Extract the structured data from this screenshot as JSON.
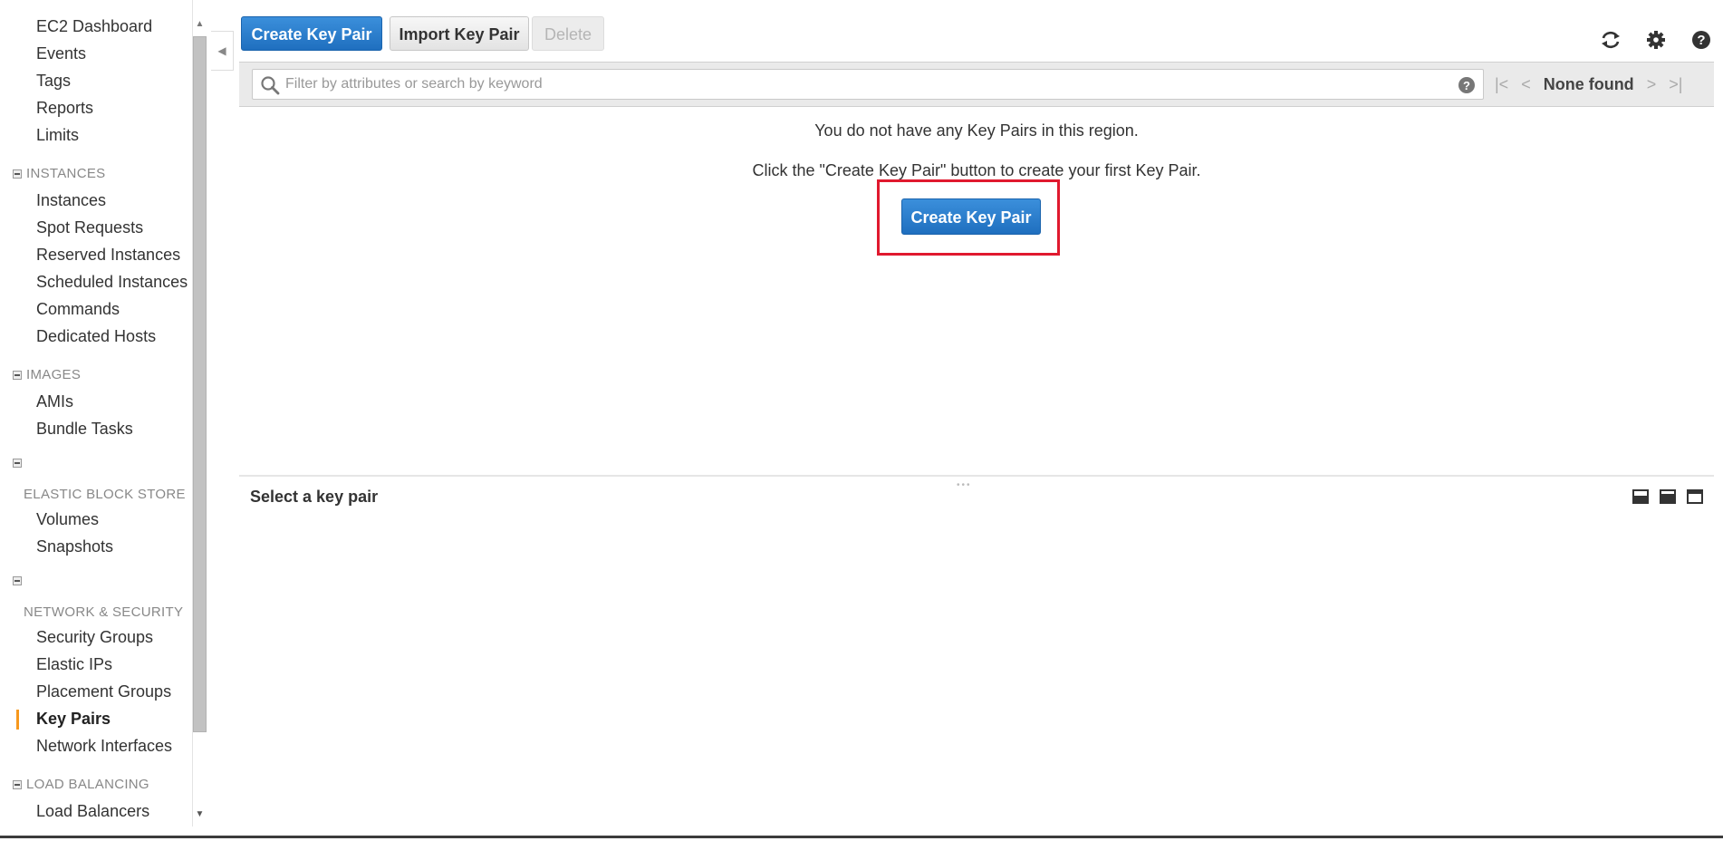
{
  "sidebar": {
    "items_top": [
      {
        "label": "EC2 Dashboard"
      },
      {
        "label": "Events"
      },
      {
        "label": "Tags"
      },
      {
        "label": "Reports"
      },
      {
        "label": "Limits"
      }
    ],
    "sections": {
      "instances": {
        "title": "INSTANCES",
        "items": [
          "Instances",
          "Spot Requests",
          "Reserved Instances",
          "Scheduled Instances",
          "Commands",
          "Dedicated Hosts"
        ]
      },
      "images": {
        "title": "IMAGES",
        "items": [
          "AMIs",
          "Bundle Tasks"
        ]
      },
      "ebs": {
        "title": "ELASTIC BLOCK STORE",
        "items": [
          "Volumes",
          "Snapshots"
        ]
      },
      "network": {
        "title": "NETWORK & SECURITY",
        "items": [
          "Security Groups",
          "Elastic IPs",
          "Placement Groups",
          "Key Pairs",
          "Network Interfaces"
        ],
        "active": "Key Pairs"
      },
      "lb": {
        "title": "LOAD BALANCING",
        "items": [
          "Load Balancers"
        ]
      }
    }
  },
  "toolbar": {
    "create_label": "Create Key Pair",
    "import_label": "Import Key Pair",
    "delete_label": "Delete",
    "icons": [
      "refresh-icon",
      "gear-icon",
      "help-icon"
    ]
  },
  "filter": {
    "placeholder": "Filter by attributes or search by keyword",
    "value": ""
  },
  "pager": {
    "status": "None found"
  },
  "empty_state": {
    "message": "You do not have any Key Pairs in this region.",
    "hint": "Click the \"Create Key Pair\" button to create your first Key Pair.",
    "button_label": "Create Key Pair",
    "highlight_color": "#e0192e"
  },
  "detail": {
    "title": "Select a key pair"
  },
  "colors": {
    "primary": "#2a7ec9",
    "active_marker": "#f7981d"
  }
}
